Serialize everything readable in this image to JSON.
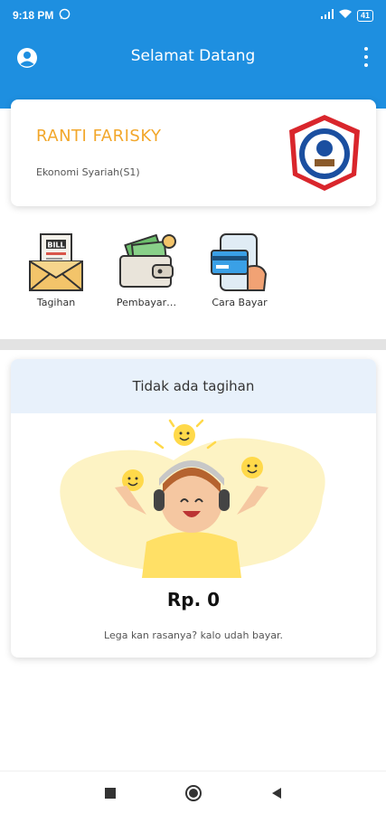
{
  "status_bar": {
    "time": "9:18 PM",
    "battery": "41"
  },
  "app_bar": {
    "title": "Selamat Datang"
  },
  "profile": {
    "name": "RANTI FARISKY",
    "program": "Ekonomi Syariah(S1)"
  },
  "menu": [
    {
      "label": "Tagihan",
      "icon": "bill-envelope-icon"
    },
    {
      "label": "Pembayar…",
      "icon": "wallet-money-icon"
    },
    {
      "label": "Cara Bayar",
      "icon": "phone-card-icon"
    }
  ],
  "bill": {
    "header": "Tidak ada tagihan",
    "amount": "Rp. 0",
    "note": "Lega kan rasanya? kalo udah bayar."
  },
  "colors": {
    "primary": "#1e8fe0",
    "accent": "#f2a72b",
    "header_bg": "#e8f1fb"
  }
}
